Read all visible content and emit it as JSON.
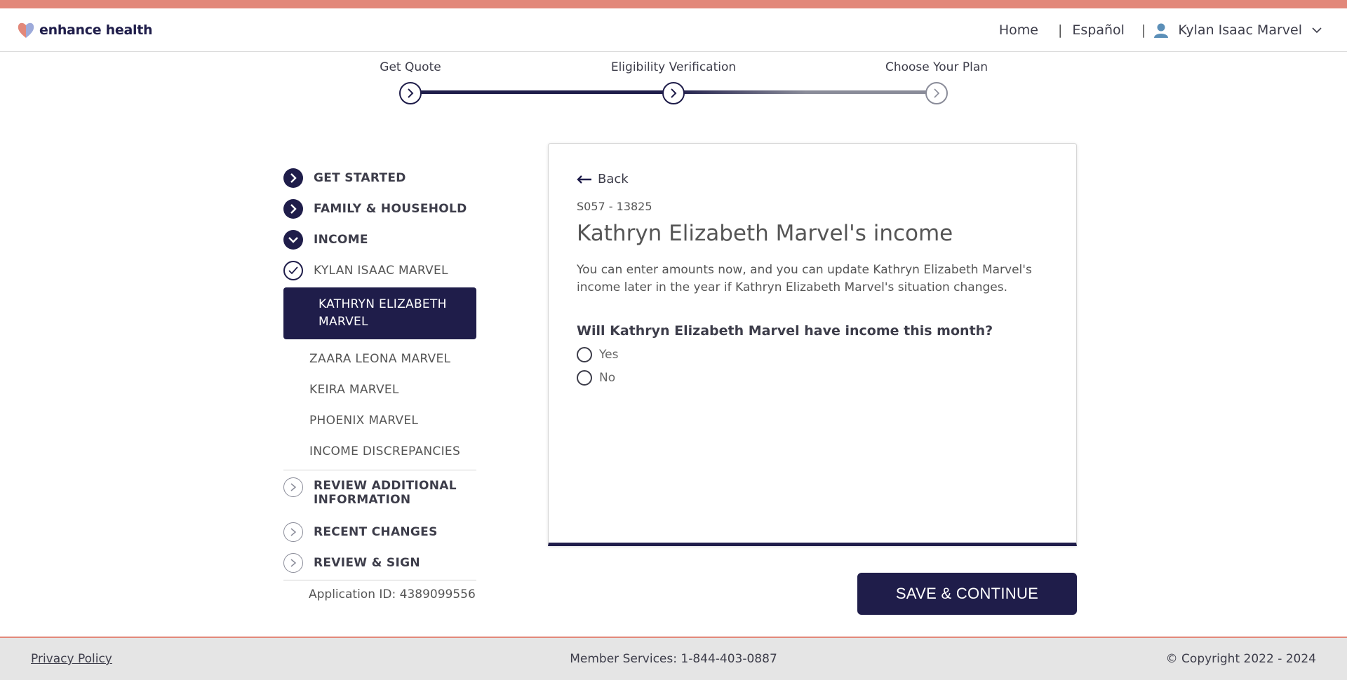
{
  "colors": {
    "accent": "#e2887a",
    "primary": "#1f1d4a",
    "muted": "#8a8c99"
  },
  "header": {
    "brand": "enhance health",
    "nav": {
      "home": "Home",
      "spanish": "Español",
      "separator": "|",
      "user": "Kylan Isaac Marvel"
    }
  },
  "stepper": {
    "steps": [
      {
        "label": "Get Quote",
        "state": "complete"
      },
      {
        "label": "Eligibility Verification",
        "state": "current"
      },
      {
        "label": "Choose Your Plan",
        "state": "upcoming"
      }
    ]
  },
  "sidebar": {
    "get_started": "GET STARTED",
    "family": "FAMILY & HOUSEHOLD",
    "income": "INCOME",
    "income_items": {
      "kylan": "KYLAN ISAAC MARVEL",
      "kathryn": "KATHRYN ELIZABETH MARVEL",
      "zaara": "ZAARA LEONA MARVEL",
      "keira": "KEIRA MARVEL",
      "phoenix": "PHOENIX MARVEL",
      "discrepancies": "INCOME DISCREPANCIES"
    },
    "review_additional": "REVIEW ADDITIONAL INFORMATION",
    "recent_changes": "RECENT CHANGES",
    "review_sign": "REVIEW & SIGN",
    "application_id": "Application ID: 4389099556"
  },
  "main": {
    "back": "Back",
    "code": "S057 - 13825",
    "title": "Kathryn Elizabeth Marvel's income",
    "description": "You can enter amounts now, and you can update Kathryn Elizabeth Marvel's income later in the year if Kathryn Elizabeth Marvel's situation changes.",
    "question": "Will Kathryn Elizabeth Marvel have income this month?",
    "options": {
      "yes": "Yes",
      "no": "No"
    },
    "save_button": "SAVE & CONTINUE"
  },
  "footer": {
    "privacy": "Privacy Policy",
    "member_services": "Member Services: 1-844-403-0887",
    "copyright": "© Copyright 2022 - 2024"
  }
}
